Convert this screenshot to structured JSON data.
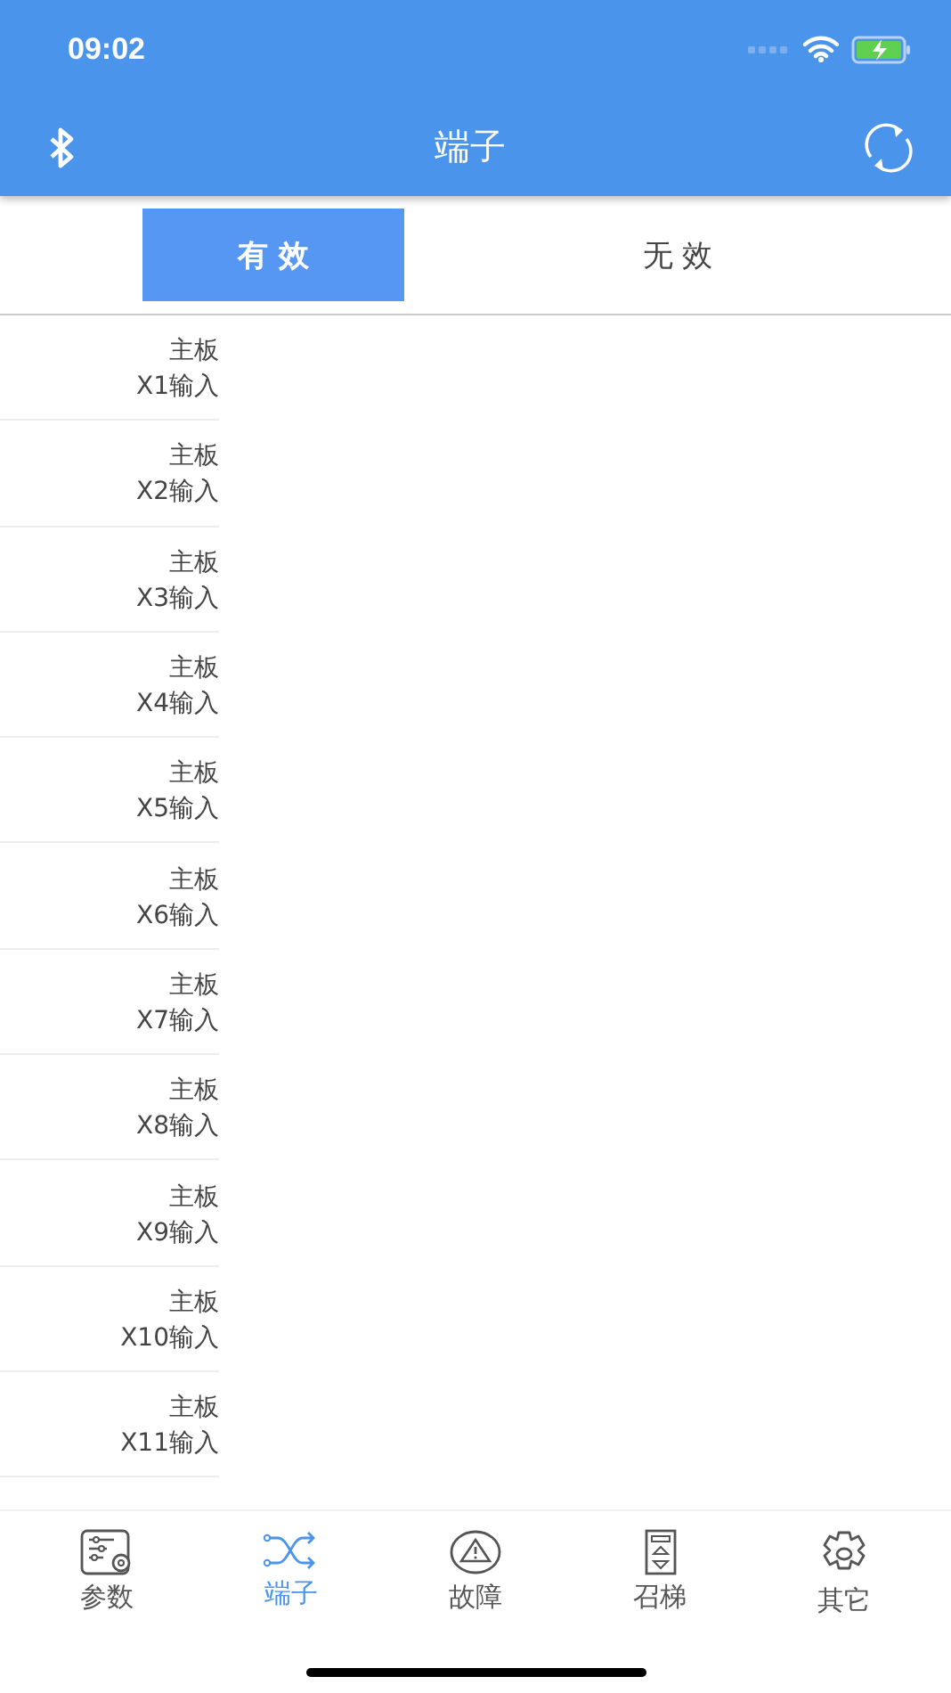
{
  "status_bar": {
    "time": "09:02"
  },
  "header": {
    "title": "端子"
  },
  "tabs": [
    {
      "label": "有 效",
      "selected": true
    },
    {
      "label": "无 效",
      "selected": false
    }
  ],
  "rows": [
    {
      "line1": "主板",
      "line2": "X1输入"
    },
    {
      "line1": "主板",
      "line2": "X2输入"
    },
    {
      "line1": "主板",
      "line2": "X3输入"
    },
    {
      "line1": "主板",
      "line2": "X4输入"
    },
    {
      "line1": "主板",
      "line2": "X5输入"
    },
    {
      "line1": "主板",
      "line2": "X6输入"
    },
    {
      "line1": "主板",
      "line2": "X7输入"
    },
    {
      "line1": "主板",
      "line2": "X8输入"
    },
    {
      "line1": "主板",
      "line2": "X9输入"
    },
    {
      "line1": "主板",
      "line2": "X10输入"
    },
    {
      "line1": "主板",
      "line2": "X11输入"
    }
  ],
  "tab_bar": [
    {
      "kind": "params",
      "label": "参数",
      "selected": false
    },
    {
      "kind": "terminals",
      "label": "端子",
      "selected": true
    },
    {
      "kind": "fault",
      "label": "故障",
      "selected": false
    },
    {
      "kind": "call",
      "label": "召梯",
      "selected": false
    },
    {
      "kind": "other",
      "label": "其它",
      "selected": false
    }
  ]
}
